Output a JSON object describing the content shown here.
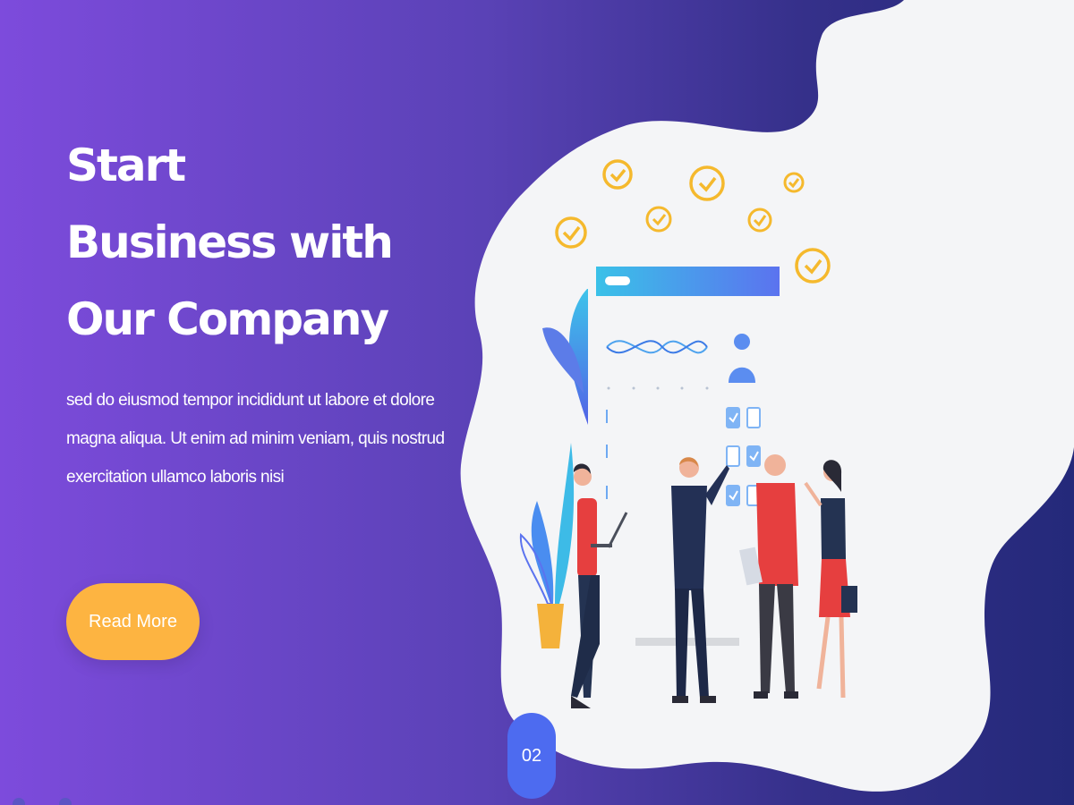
{
  "hero": {
    "title_lines": [
      "Start",
      "Business with",
      "Our Company"
    ],
    "description_lines": [
      "sed do eiusmod tempor incididunt ut labore et dolore",
      "magna aliqua. Ut enim ad minim veniam, quis nostrud",
      "exercitation ullamco laboris nisi"
    ],
    "cta_label": "Read More"
  },
  "slider": {
    "current_slide_label": "02"
  },
  "colors": {
    "gradient_start": "#7d4bdc",
    "gradient_end": "#24297a",
    "cta": "#fdb441",
    "indicator": "#4d6bf0",
    "blob": "#f4f5f7",
    "check_circle": "#f5b92d"
  },
  "illustration": {
    "icons": [
      "checkmark-circle-icon",
      "dashboard-board",
      "people-team",
      "plant-pot",
      "leaf-decoration"
    ]
  }
}
